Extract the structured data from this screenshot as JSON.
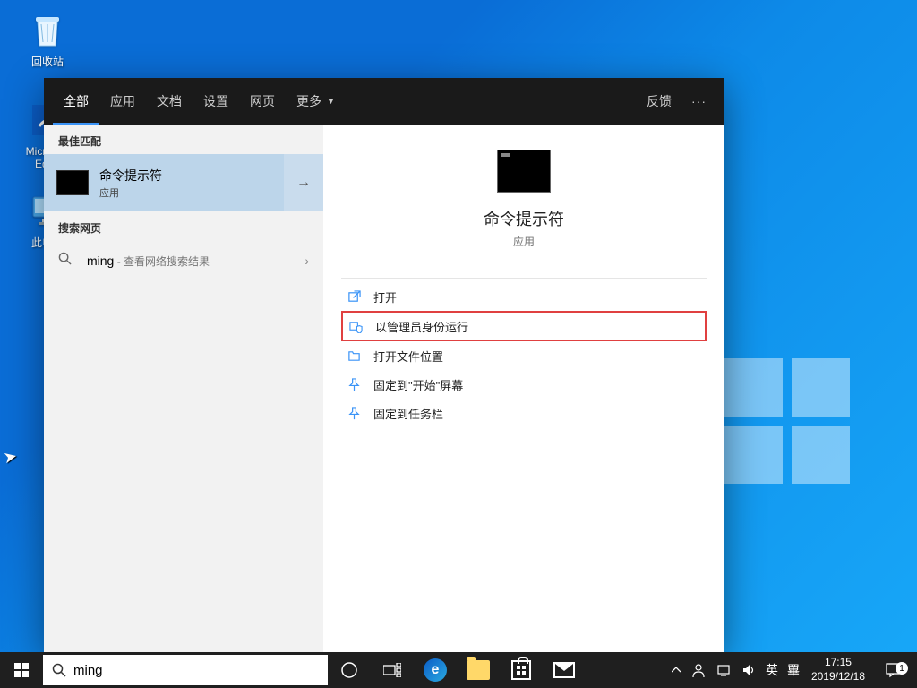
{
  "desktop": {
    "recycle_bin": "回收站",
    "edge": "Microsoft Edge",
    "this_pc": "此电脑"
  },
  "search_panel": {
    "tabs": {
      "all": "全部",
      "apps": "应用",
      "docs": "文档",
      "settings": "设置",
      "web": "网页",
      "more": "更多"
    },
    "feedback": "反馈",
    "dots": "···",
    "section_best": "最佳匹配",
    "best_match": {
      "title": "命令提示符",
      "kind": "应用"
    },
    "section_web": "搜索网页",
    "web_results": {
      "query": "ming",
      "suffix": " - 查看网络搜索结果"
    },
    "preview": {
      "title": "命令提示符",
      "kind": "应用",
      "actions": {
        "open": "打开",
        "run_admin": "以管理员身份运行",
        "open_loc": "打开文件位置",
        "pin_start": "固定到\"开始\"屏幕",
        "pin_taskbar": "固定到任务栏"
      }
    }
  },
  "taskbar": {
    "search_value": "ming",
    "ime_lang": "英",
    "ime_mode": "罼",
    "time": "17:15",
    "date": "2019/12/18",
    "notif_count": "1"
  }
}
